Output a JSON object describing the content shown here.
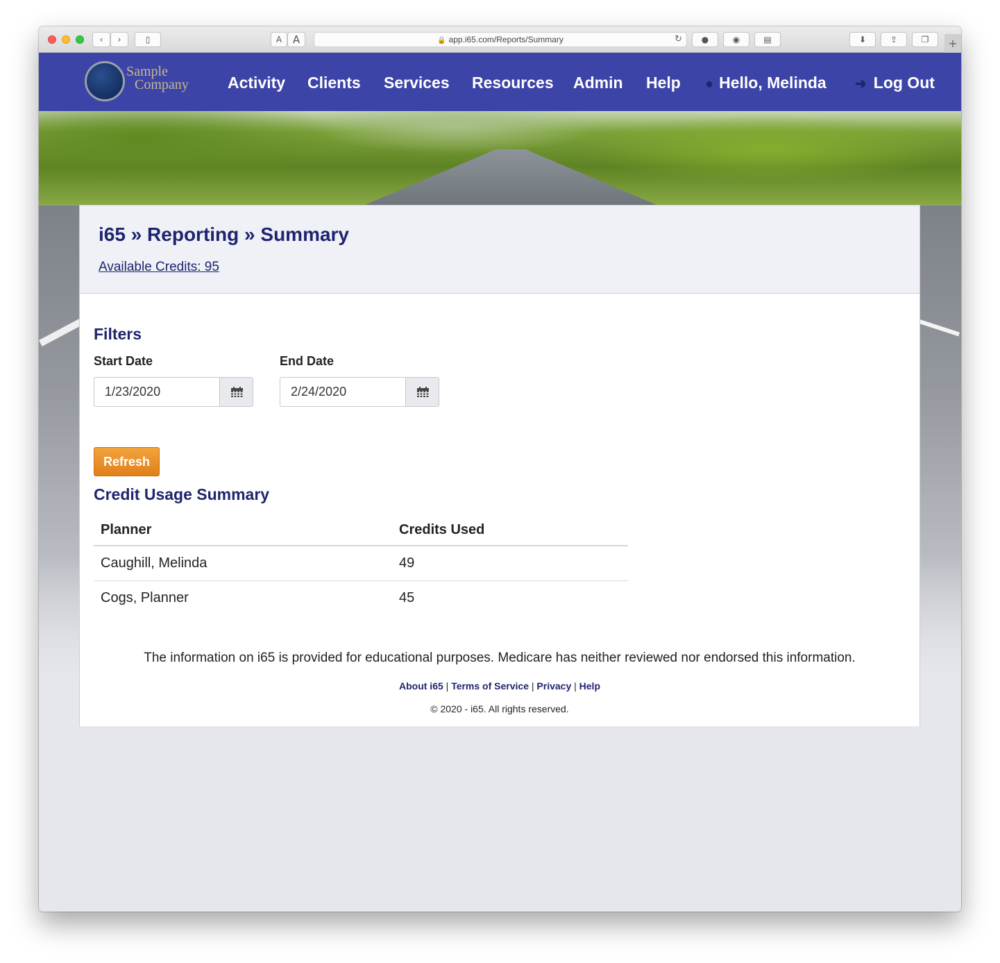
{
  "browser": {
    "url": "app.i65.com/Reports/Summary",
    "text_size_small": "A",
    "text_size_large": "A"
  },
  "nav": {
    "logo_line1": "Sample",
    "logo_line2": "Company",
    "items": [
      "Activity",
      "Clients",
      "Services",
      "Resources",
      "Admin",
      "Help"
    ],
    "greeting": "Hello, Melinda",
    "logout": "Log Out"
  },
  "header": {
    "breadcrumb": "i65 » Reporting » Summary",
    "available_credits": "Available Credits: 95"
  },
  "filters": {
    "title": "Filters",
    "start_label": "Start Date",
    "start_value": "1/23/2020",
    "end_label": "End Date",
    "end_value": "2/24/2020",
    "refresh_label": "Refresh"
  },
  "summary": {
    "title": "Credit Usage Summary",
    "columns": [
      "Planner",
      "Credits Used"
    ],
    "rows": [
      [
        "Caughill, Melinda",
        "49"
      ],
      [
        "Cogs, Planner",
        "45"
      ]
    ]
  },
  "footer": {
    "disclaimer": "The information on i65 is provided for educational purposes. Medicare has neither reviewed nor endorsed this information.",
    "links": [
      "About i65",
      "Terms of Service",
      "Privacy",
      "Help"
    ],
    "separator": "|",
    "copyright": "© 2020 - i65. All rights reserved."
  }
}
